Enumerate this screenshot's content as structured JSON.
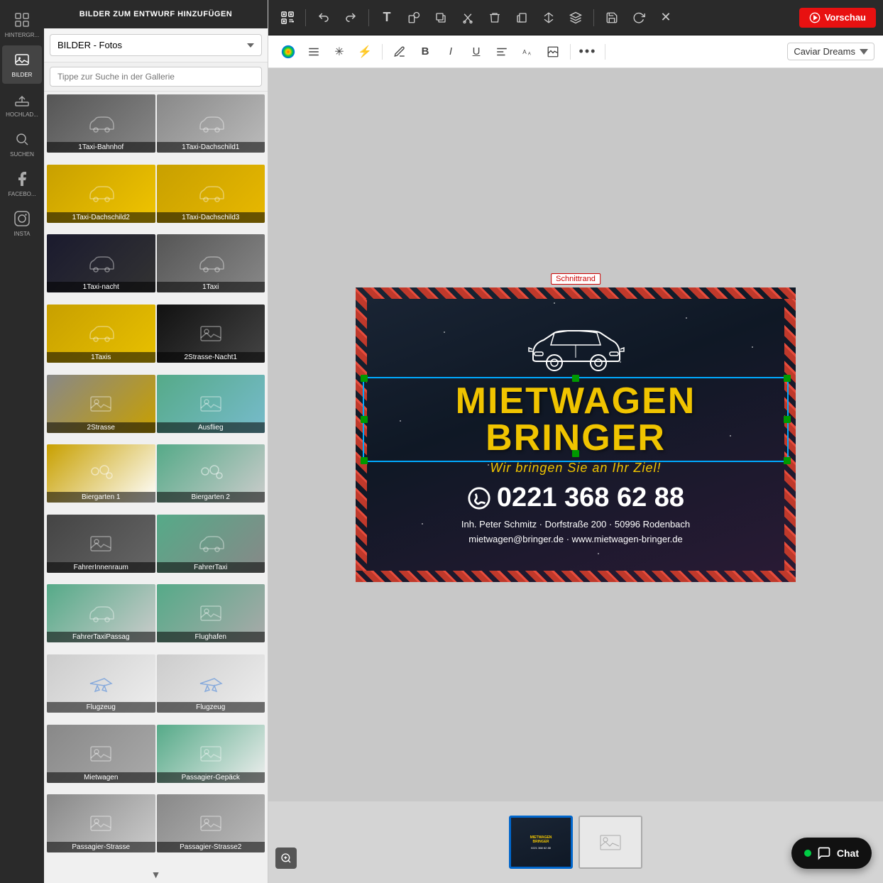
{
  "sidebar": {
    "items": [
      {
        "id": "hintergrund",
        "label": "HINTERGR...",
        "icon": "grid-icon"
      },
      {
        "id": "bilder",
        "label": "BILDER",
        "icon": "image-icon"
      },
      {
        "id": "hochlad",
        "label": "HOCHLAD...",
        "icon": "upload-icon"
      },
      {
        "id": "suchen",
        "label": "SUCHEN",
        "icon": "search-icon"
      },
      {
        "id": "facebook",
        "label": "FACEBO...",
        "icon": "facebook-icon"
      },
      {
        "id": "insta",
        "label": "INSTA",
        "icon": "instagram-icon"
      }
    ]
  },
  "panel": {
    "header": "BILDER ZUM ENTWURF HINZUFÜGEN",
    "dropdown_value": "BILDER - Fotos",
    "search_placeholder": "Tippe zur Suche in der Gallerie",
    "images": [
      {
        "id": "1",
        "label": "1Taxi-Bahnhof",
        "class": "img-taxi1"
      },
      {
        "id": "2",
        "label": "1Taxi-Dachschild1",
        "class": "img-taxi2"
      },
      {
        "id": "3",
        "label": "1Taxi-Dachschild2",
        "class": "img-taxi3"
      },
      {
        "id": "4",
        "label": "1Taxi-Dachschild3",
        "class": "img-taxi4"
      },
      {
        "id": "5",
        "label": "1Taxi-nacht",
        "class": "img-night"
      },
      {
        "id": "6",
        "label": "1Taxi",
        "class": "img-taxi5"
      },
      {
        "id": "7",
        "label": "1Taxis",
        "class": "img-taxis"
      },
      {
        "id": "8",
        "label": "2Strasse-Nacht1",
        "class": "img-night2"
      },
      {
        "id": "9",
        "label": "2Strasse",
        "class": "img-street"
      },
      {
        "id": "10",
        "label": "Ausflieg",
        "class": "img-ausflug"
      },
      {
        "id": "11",
        "label": "Biergarten 1",
        "class": "img-bier1"
      },
      {
        "id": "12",
        "label": "Biergarten 2",
        "class": "img-bier2"
      },
      {
        "id": "13",
        "label": "FahrerInnenraum",
        "class": "img-fahrerinnen"
      },
      {
        "id": "14",
        "label": "FahrerTaxi",
        "class": "img-fahrertaxi"
      },
      {
        "id": "15",
        "label": "FahrerTaxiPassag",
        "class": "img-fahrerpass"
      },
      {
        "id": "16",
        "label": "Flughafen",
        "class": "img-flughafen"
      },
      {
        "id": "17",
        "label": "Flugzeug",
        "class": "img-flugzeug1"
      },
      {
        "id": "18",
        "label": "Flugzeug",
        "class": "img-flugzeug2"
      },
      {
        "id": "19",
        "label": "Mietwagen",
        "class": "img-mietwagen"
      },
      {
        "id": "20",
        "label": "Passagier-Gepäck",
        "class": "img-passgepaeck"
      },
      {
        "id": "21",
        "label": "Passagier-Strasse",
        "class": "img-passstrasse"
      },
      {
        "id": "22",
        "label": "Passagier-Strasse2",
        "class": "img-passstrasse2"
      }
    ]
  },
  "toolbar_top": {
    "buttons": [
      {
        "id": "qr",
        "icon": "qr-icon",
        "symbol": "⊞"
      },
      {
        "id": "undo",
        "icon": "undo-icon",
        "symbol": "↩"
      },
      {
        "id": "redo",
        "icon": "redo-icon",
        "symbol": "↪"
      },
      {
        "id": "text",
        "icon": "text-icon",
        "symbol": "T"
      },
      {
        "id": "shapes",
        "icon": "shapes-icon",
        "symbol": "◻"
      },
      {
        "id": "copy2",
        "icon": "copy2-icon",
        "symbol": "❑"
      },
      {
        "id": "cut",
        "icon": "cut-icon",
        "symbol": "✂"
      },
      {
        "id": "delete",
        "icon": "delete-icon",
        "symbol": "🗑"
      },
      {
        "id": "paste",
        "icon": "paste-icon",
        "symbol": "📋"
      },
      {
        "id": "flip",
        "icon": "flip-icon",
        "symbol": "⇔"
      },
      {
        "id": "layers",
        "icon": "layers-icon",
        "symbol": "≡"
      },
      {
        "id": "save",
        "icon": "save-icon",
        "symbol": "💾"
      },
      {
        "id": "refresh",
        "icon": "refresh-icon",
        "symbol": "🔄"
      },
      {
        "id": "close",
        "icon": "close-icon",
        "symbol": "✕"
      }
    ],
    "preview_label": "Vorschau"
  },
  "toolbar_secondary": {
    "buttons": [
      {
        "id": "color",
        "icon": "color-icon",
        "symbol": "🎨"
      },
      {
        "id": "align",
        "icon": "align-icon",
        "symbol": "≡"
      },
      {
        "id": "sparkle",
        "icon": "sparkle-icon",
        "symbol": "✳"
      },
      {
        "id": "lightning",
        "icon": "lightning-icon",
        "symbol": "⚡"
      },
      {
        "id": "pen",
        "icon": "pen-icon",
        "symbol": "✎"
      },
      {
        "id": "bold",
        "icon": "bold-icon",
        "symbol": "B"
      },
      {
        "id": "italic",
        "icon": "italic-icon",
        "symbol": "I"
      },
      {
        "id": "underline",
        "icon": "underline-icon",
        "symbol": "U"
      },
      {
        "id": "text-align",
        "icon": "text-align-icon",
        "symbol": "≡"
      },
      {
        "id": "text-size",
        "icon": "text-size-icon",
        "symbol": "A↕"
      },
      {
        "id": "image-crop",
        "icon": "image-crop-icon",
        "symbol": "⊡"
      },
      {
        "id": "more",
        "icon": "more-icon",
        "symbol": "•••"
      }
    ],
    "font_name": "Caviar Dreams"
  },
  "flyer": {
    "schnittrand": "Schnittrand",
    "title": "MIETWAGEN BRINGER",
    "subtitle": "Wir bringen Sie an Ihr Ziel!",
    "phone": "0221 368 62 88",
    "address_line1": "Inh. Peter Schmitz · Dorfstraße 200 · 50996 Rodenbach",
    "address_line2": "mietwagen@bringer.de · www.mietwagen-bringer.de"
  },
  "bottom": {
    "thumbnails": [
      {
        "id": "page1",
        "active": true,
        "label": "MIETWAGEN BRINGER"
      },
      {
        "id": "page2",
        "active": false,
        "label": ""
      }
    ],
    "chat_label": "Chat",
    "zoom_symbol": "🔍"
  }
}
